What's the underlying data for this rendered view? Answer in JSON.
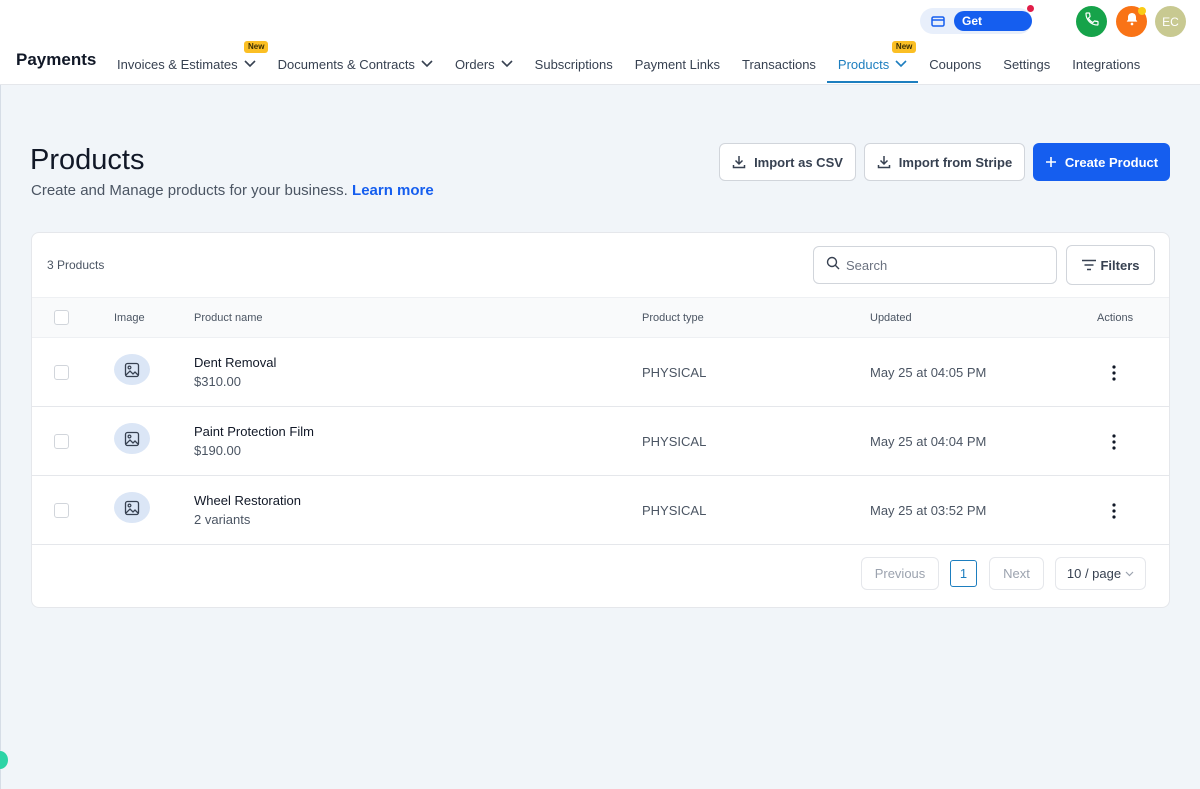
{
  "header": {
    "get_started": "Get Started",
    "avatar_initials": "EC",
    "colors": {
      "phone": "#16a34a",
      "bell": "#f97316",
      "primary": "#155eef",
      "active_tab": "#1d7ebf"
    }
  },
  "app": {
    "title": "Payments"
  },
  "nav": {
    "items": [
      {
        "label": "Invoices & Estimates",
        "badge": "New",
        "dropdown": true
      },
      {
        "label": "Documents & Contracts",
        "dropdown": true
      },
      {
        "label": "Orders",
        "dropdown": true
      },
      {
        "label": "Subscriptions"
      },
      {
        "label": "Payment Links"
      },
      {
        "label": "Transactions"
      },
      {
        "label": "Products",
        "badge": "New",
        "dropdown": true,
        "active": true
      },
      {
        "label": "Coupons"
      },
      {
        "label": "Settings"
      },
      {
        "label": "Integrations"
      }
    ]
  },
  "page": {
    "title": "Products",
    "subtitle": "Create and Manage products for your business.",
    "learn_more": "Learn more"
  },
  "actions": {
    "import_csv": "Import as CSV",
    "import_stripe": "Import from Stripe",
    "create_product": "Create Product"
  },
  "table": {
    "count_label": "3 Products",
    "search_placeholder": "Search",
    "filters_label": "Filters",
    "columns": {
      "image": "Image",
      "name": "Product name",
      "type": "Product type",
      "updated": "Updated",
      "actions": "Actions"
    },
    "rows": [
      {
        "name": "Dent Removal",
        "sub": "$310.00",
        "type": "PHYSICAL",
        "updated": "May 25 at 04:05 PM"
      },
      {
        "name": "Paint Protection Film",
        "sub": "$190.00",
        "type": "PHYSICAL",
        "updated": "May 25 at 04:04 PM"
      },
      {
        "name": "Wheel Restoration",
        "sub": "2 variants",
        "type": "PHYSICAL",
        "updated": "May 25 at 03:52 PM"
      }
    ]
  },
  "pagination": {
    "previous": "Previous",
    "current_page": "1",
    "next": "Next",
    "page_size": "10 / page"
  }
}
